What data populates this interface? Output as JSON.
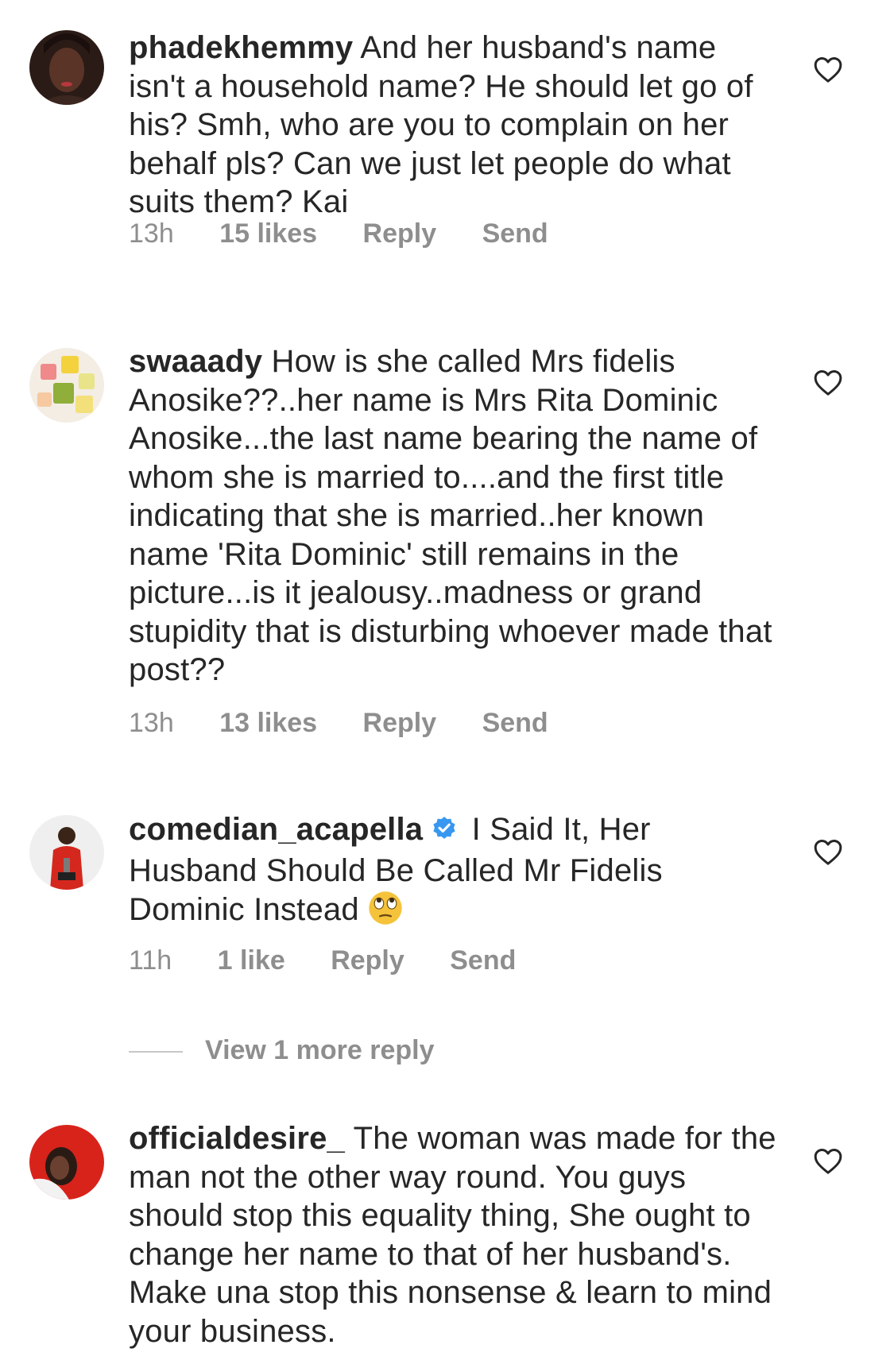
{
  "comments": [
    {
      "username": "phadekhemmy",
      "text": "And her husband's name isn't a household name? He should let go of his?  Smh, who are you to complain on her behalf pls?  Can we just let people do what suits them? Kai",
      "time": "13h",
      "likes": "15 likes",
      "reply_label": "Reply",
      "send_label": "Send",
      "avatar_icon": "user-avatar-icon"
    },
    {
      "username": "swaaady",
      "text": "How is she called Mrs fidelis Anosike??..her name is Mrs Rita Dominic Anosike...the last name bearing the name of whom she is married to....and the first title indicating that she is married..her known name 'Rita Dominic' still remains in the picture...is it jealousy..madness or grand stupidity that is disturbing whoever made that post??",
      "time": "13h",
      "likes": "13 likes",
      "reply_label": "Reply",
      "send_label": "Send",
      "avatar_icon": "fruit-cubes-avatar-icon"
    },
    {
      "username": "comedian_acapella",
      "verified": true,
      "text": "I Said It, Her Husband Should Be Called Mr Fidelis Dominic Instead",
      "emoji": "eye-roll-emoji",
      "time": "11h",
      "likes": "1 like",
      "reply_label": "Reply",
      "send_label": "Send",
      "avatar_icon": "man-in-red-avatar-icon",
      "more_replies": "View 1 more reply"
    },
    {
      "username": "officialdesire_",
      "text": "The woman was made for the man not the other way round. You guys should stop this equality thing, She ought to change her name to that of her husband's. Make una stop this nonsense & learn to mind your business.",
      "avatar_icon": "red-portrait-avatar-icon"
    }
  ],
  "colors": {
    "text": "#262626",
    "meta": "#8e8e8e",
    "verified": "#3897f0",
    "heart": "#262626"
  },
  "icons": {
    "like": "heart-outline-icon",
    "verified": "verified-badge-icon"
  }
}
